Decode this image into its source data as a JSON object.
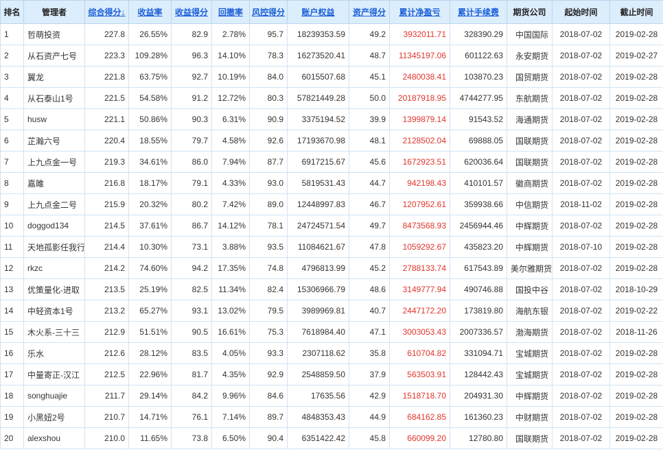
{
  "colors": {
    "header_bg": "#dcedfc",
    "link": "#1a5fd6",
    "profit": "#e0352b",
    "grid": "#cfe4f6"
  },
  "columns": [
    {
      "label": "排名",
      "sortable": false
    },
    {
      "label": "管理者",
      "sortable": false
    },
    {
      "label": "综合得分↓",
      "sortable": true
    },
    {
      "label": "收益率",
      "sortable": true
    },
    {
      "label": "收益得分",
      "sortable": true
    },
    {
      "label": "回撤率",
      "sortable": true
    },
    {
      "label": "风控得分",
      "sortable": true
    },
    {
      "label": "账户权益",
      "sortable": true
    },
    {
      "label": "资产得分",
      "sortable": true
    },
    {
      "label": "累计净盈亏",
      "sortable": true
    },
    {
      "label": "累计手续费",
      "sortable": true
    },
    {
      "label": "期货公司",
      "sortable": false
    },
    {
      "label": "起始时间",
      "sortable": false
    },
    {
      "label": "截止时间",
      "sortable": false
    }
  ],
  "rows": [
    [
      "1",
      "哲萌投资",
      "227.8",
      "26.55%",
      "82.9",
      "2.78%",
      "95.7",
      "18239353.59",
      "49.2",
      "3932011.71",
      "328390.29",
      "中国国际",
      "2018-07-02",
      "2019-02-28"
    ],
    [
      "2",
      "从石资产七号",
      "223.3",
      "109.28%",
      "96.3",
      "14.10%",
      "78.3",
      "16273520.41",
      "48.7",
      "11345197.06",
      "601122.63",
      "永安期货",
      "2018-07-02",
      "2019-02-27"
    ],
    [
      "3",
      "翼龙",
      "221.8",
      "63.75%",
      "92.7",
      "10.19%",
      "84.0",
      "6015507.68",
      "45.1",
      "2480038.41",
      "103870.23",
      "国贸期货",
      "2018-07-02",
      "2019-02-28"
    ],
    [
      "4",
      "从石泰山1号",
      "221.5",
      "54.58%",
      "91.2",
      "12.72%",
      "80.3",
      "57821449.28",
      "50.0",
      "20187918.95",
      "4744277.95",
      "东航期货",
      "2018-07-02",
      "2019-02-28"
    ],
    [
      "5",
      "husw",
      "221.1",
      "50.86%",
      "90.3",
      "6.31%",
      "90.9",
      "3375194.52",
      "39.9",
      "1399879.14",
      "91543.52",
      "海通期货",
      "2018-07-02",
      "2019-02-28"
    ],
    [
      "6",
      "芷瀚六号",
      "220.4",
      "18.55%",
      "79.7",
      "4.58%",
      "92.6",
      "17193670.98",
      "48.1",
      "2128502.04",
      "69888.05",
      "国联期货",
      "2018-07-02",
      "2019-02-28"
    ],
    [
      "7",
      "上九点金一号",
      "219.3",
      "34.61%",
      "86.0",
      "7.94%",
      "87.7",
      "6917215.67",
      "45.6",
      "1672923.51",
      "620036.64",
      "国联期货",
      "2018-07-02",
      "2019-02-28"
    ],
    [
      "8",
      "嘉雎",
      "216.8",
      "18.17%",
      "79.1",
      "4.33%",
      "93.0",
      "5819531.43",
      "44.7",
      "942198.43",
      "410101.57",
      "徽商期货",
      "2018-07-02",
      "2019-02-28"
    ],
    [
      "9",
      "上九点金二号",
      "215.9",
      "20.32%",
      "80.2",
      "7.42%",
      "89.0",
      "12448997.83",
      "46.7",
      "1207952.61",
      "359938.66",
      "中信期货",
      "2018-11-02",
      "2019-02-28"
    ],
    [
      "10",
      "doggod134",
      "214.5",
      "37.61%",
      "86.7",
      "14.12%",
      "78.1",
      "24724571.54",
      "49.7",
      "8473568.93",
      "2456944.46",
      "中辉期货",
      "2018-07-02",
      "2019-02-28"
    ],
    [
      "11",
      "天地孤影任我行",
      "214.4",
      "10.30%",
      "73.1",
      "3.88%",
      "93.5",
      "11084621.67",
      "47.8",
      "1059292.67",
      "435823.20",
      "中辉期货",
      "2018-07-10",
      "2019-02-28"
    ],
    [
      "12",
      "rkzc",
      "214.2",
      "74.60%",
      "94.2",
      "17.35%",
      "74.8",
      "4796813.99",
      "45.2",
      "2788133.74",
      "617543.89",
      "美尔雅期货",
      "2018-07-02",
      "2019-02-28"
    ],
    [
      "13",
      "优策量化-进取",
      "213.5",
      "25.19%",
      "82.5",
      "11.34%",
      "82.4",
      "15306966.79",
      "48.6",
      "3149777.94",
      "490746.88",
      "国投中谷",
      "2018-07-02",
      "2018-10-29"
    ],
    [
      "14",
      "中轻资本1号",
      "213.2",
      "65.27%",
      "93.1",
      "13.02%",
      "79.5",
      "3989969.81",
      "40.7",
      "2447172.20",
      "173819.80",
      "海航东银",
      "2018-07-02",
      "2019-02-22"
    ],
    [
      "15",
      "木火系-三十三",
      "212.9",
      "51.51%",
      "90.5",
      "16.61%",
      "75.3",
      "7618984.40",
      "47.1",
      "3003053.43",
      "2007336.57",
      "渤海期货",
      "2018-07-02",
      "2018-11-26"
    ],
    [
      "16",
      "乐水",
      "212.6",
      "28.12%",
      "83.5",
      "4.05%",
      "93.3",
      "2307118.62",
      "35.8",
      "610704.82",
      "331094.71",
      "宝城期货",
      "2018-07-02",
      "2019-02-28"
    ],
    [
      "17",
      "中量寄正-汉江",
      "212.5",
      "22.96%",
      "81.7",
      "4.35%",
      "92.9",
      "2548859.50",
      "37.9",
      "563503.91",
      "128442.43",
      "宝城期货",
      "2018-07-02",
      "2019-02-28"
    ],
    [
      "18",
      "songhuajie",
      "211.7",
      "29.14%",
      "84.2",
      "9.96%",
      "84.6",
      "17635.56",
      "42.9",
      "1518718.70",
      "204931.30",
      "中辉期货",
      "2018-07-02",
      "2019-02-28"
    ],
    [
      "19",
      "小黑妞2号",
      "210.7",
      "14.71%",
      "76.1",
      "7.14%",
      "89.7",
      "4848353.43",
      "44.9",
      "684162.85",
      "161360.23",
      "中财期货",
      "2018-07-02",
      "2019-02-28"
    ],
    [
      "20",
      "alexshou",
      "210.0",
      "11.65%",
      "73.8",
      "6.50%",
      "90.4",
      "6351422.42",
      "45.8",
      "660099.20",
      "12780.80",
      "国联期货",
      "2018-07-02",
      "2019-02-28"
    ]
  ]
}
